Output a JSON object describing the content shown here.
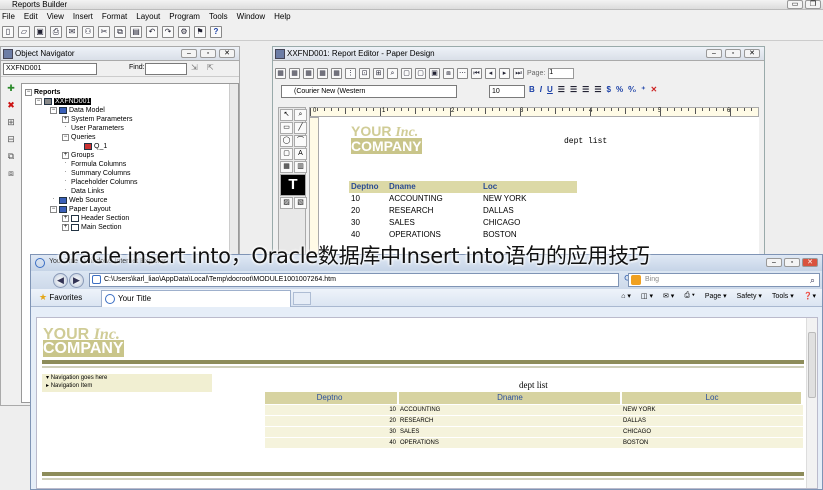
{
  "app": {
    "title": "Reports Builder",
    "menu": [
      "File",
      "Edit",
      "View",
      "Insert",
      "Format",
      "Layout",
      "Program",
      "Tools",
      "Window",
      "Help"
    ]
  },
  "object_navigator": {
    "title": "Object Navigator",
    "selector_value": "XXFND001",
    "find_label": "Find:",
    "tree": {
      "root": "Reports",
      "report": "XXFND001",
      "data_model": "Data Model",
      "data_model_children": [
        "System Parameters",
        "User Parameters",
        "Queries",
        "Q_1",
        "Groups",
        "Formula Columns",
        "Summary Columns",
        "Placeholder Columns",
        "Data Links"
      ],
      "web_source": "Web Source",
      "paper_layout": "Paper Layout",
      "paper_layout_children": [
        "Header Section",
        "Main Section"
      ]
    }
  },
  "report_editor": {
    "title": "XXFND001: Report Editor - Paper Design",
    "page_label": "Page:",
    "page_value": "1",
    "font_value": "(Courier New (Western",
    "font_size": "10",
    "fmt_buttons": [
      "B",
      "I",
      "U"
    ],
    "ruler_numbers": [
      "0",
      "1",
      "2",
      "3",
      "4",
      "5",
      "6"
    ],
    "canvas": {
      "logo_line1": "YOUR",
      "logo_inc": "Inc.",
      "logo_line2": "COMPANY",
      "report_title": "dept list",
      "columns": [
        "Deptno",
        "Dname",
        "Loc"
      ],
      "rows": [
        [
          "10",
          "ACCOUNTING",
          "NEW YORK"
        ],
        [
          "20",
          "RESEARCH",
          "DALLAS"
        ],
        [
          "30",
          "SALES",
          "CHICAGO"
        ],
        [
          "40",
          "OPERATIONS",
          "BOSTON"
        ]
      ]
    }
  },
  "overlay_heading": "oracle insert into，Oracle数据库中Insert into语句的应用技巧",
  "browser": {
    "title": "Your Title - Windows Internet Explorer",
    "address": "C:\\Users\\karl_liao\\AppData\\Local\\Temp\\docroot\\MODULE1001007264.htm",
    "search_placeholder": "Bing",
    "favorites_label": "Favorites",
    "tab_title": "Your Title",
    "command_bar": [
      "Page ▾",
      "Safety ▾",
      "Tools ▾"
    ],
    "page": {
      "logo_line1": "YOUR",
      "logo_inc": "Inc.",
      "logo_line2": "COMPANY",
      "nav_lines": [
        "Navigation goes here",
        "Navigation Item"
      ],
      "report_title": "dept list",
      "columns": [
        "Deptno",
        "Dname",
        "Loc"
      ],
      "rows": [
        [
          "10",
          "ACCOUNTING",
          "NEW YORK"
        ],
        [
          "20",
          "RESEARCH",
          "DALLAS"
        ],
        [
          "30",
          "SALES",
          "CHICAGO"
        ],
        [
          "40",
          "OPERATIONS",
          "BOSTON"
        ]
      ]
    }
  }
}
